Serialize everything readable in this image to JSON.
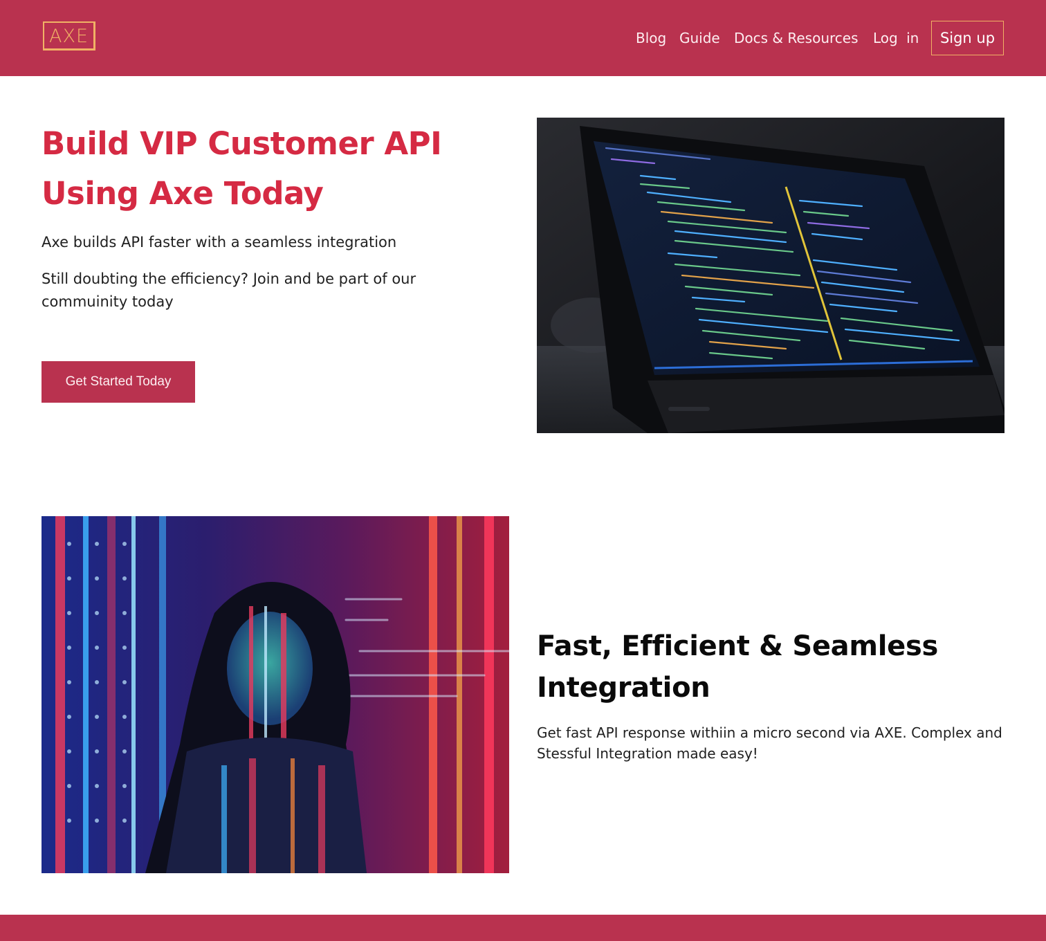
{
  "header": {
    "logo_text": "AXE",
    "nav": {
      "blog": "Blog",
      "guide": "Guide",
      "docs": "Docs & Resources",
      "login": "Log in"
    },
    "signup_label": "Sign up"
  },
  "hero": {
    "title": "Build VIP Customer API Using Axe Today",
    "subtitle": "Axe builds API faster with a seamless integration",
    "subtitle2": "Still doubting the efficiency? Join and be part of our commuinity today",
    "cta_label": "Get Started Today"
  },
  "feature": {
    "title": "Fast, Efficient & Seamless Integration",
    "text": "Get fast API response withiin a micro second via AXE. Complex and Stessful Integration made easy!"
  },
  "colors": {
    "brand": "#b9324f",
    "accent": "#f1b265",
    "headline": "#d52a43"
  },
  "images": {
    "hero_image": "laptop-code-photo",
    "feature_image": "woman-code-projection-photo"
  }
}
